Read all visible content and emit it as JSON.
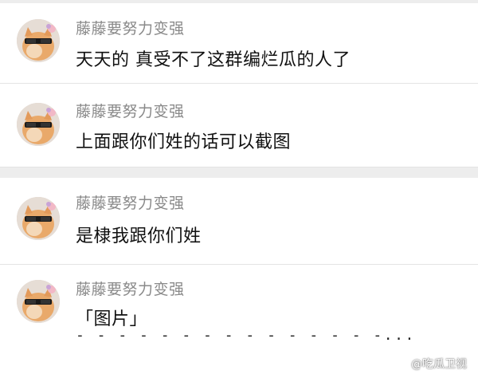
{
  "comments": [
    {
      "author": "藤藤要努力变强",
      "text": "天天的 真受不了这群编烂瓜的人了",
      "avatar_icon": "cat-sunglasses-avatar"
    },
    {
      "author": "藤藤要努力变强",
      "text": "上面跟你们姓的话可以截图",
      "avatar_icon": "cat-sunglasses-avatar"
    },
    {
      "author": "藤藤要努力变强",
      "text": "是棣我跟你们姓",
      "avatar_icon": "cat-sunglasses-avatar"
    },
    {
      "author": "藤藤要努力变强",
      "text": "「图片」",
      "continuation": "- - - - - - - - - - - - - - -...",
      "avatar_icon": "cat-sunglasses-avatar"
    }
  ],
  "watermark": {
    "text": "@吃瓜卫视",
    "icon": "weibo-logo-icon"
  },
  "colors": {
    "name": "#8a8a8a",
    "text": "#111111",
    "separator": "#ededed"
  }
}
